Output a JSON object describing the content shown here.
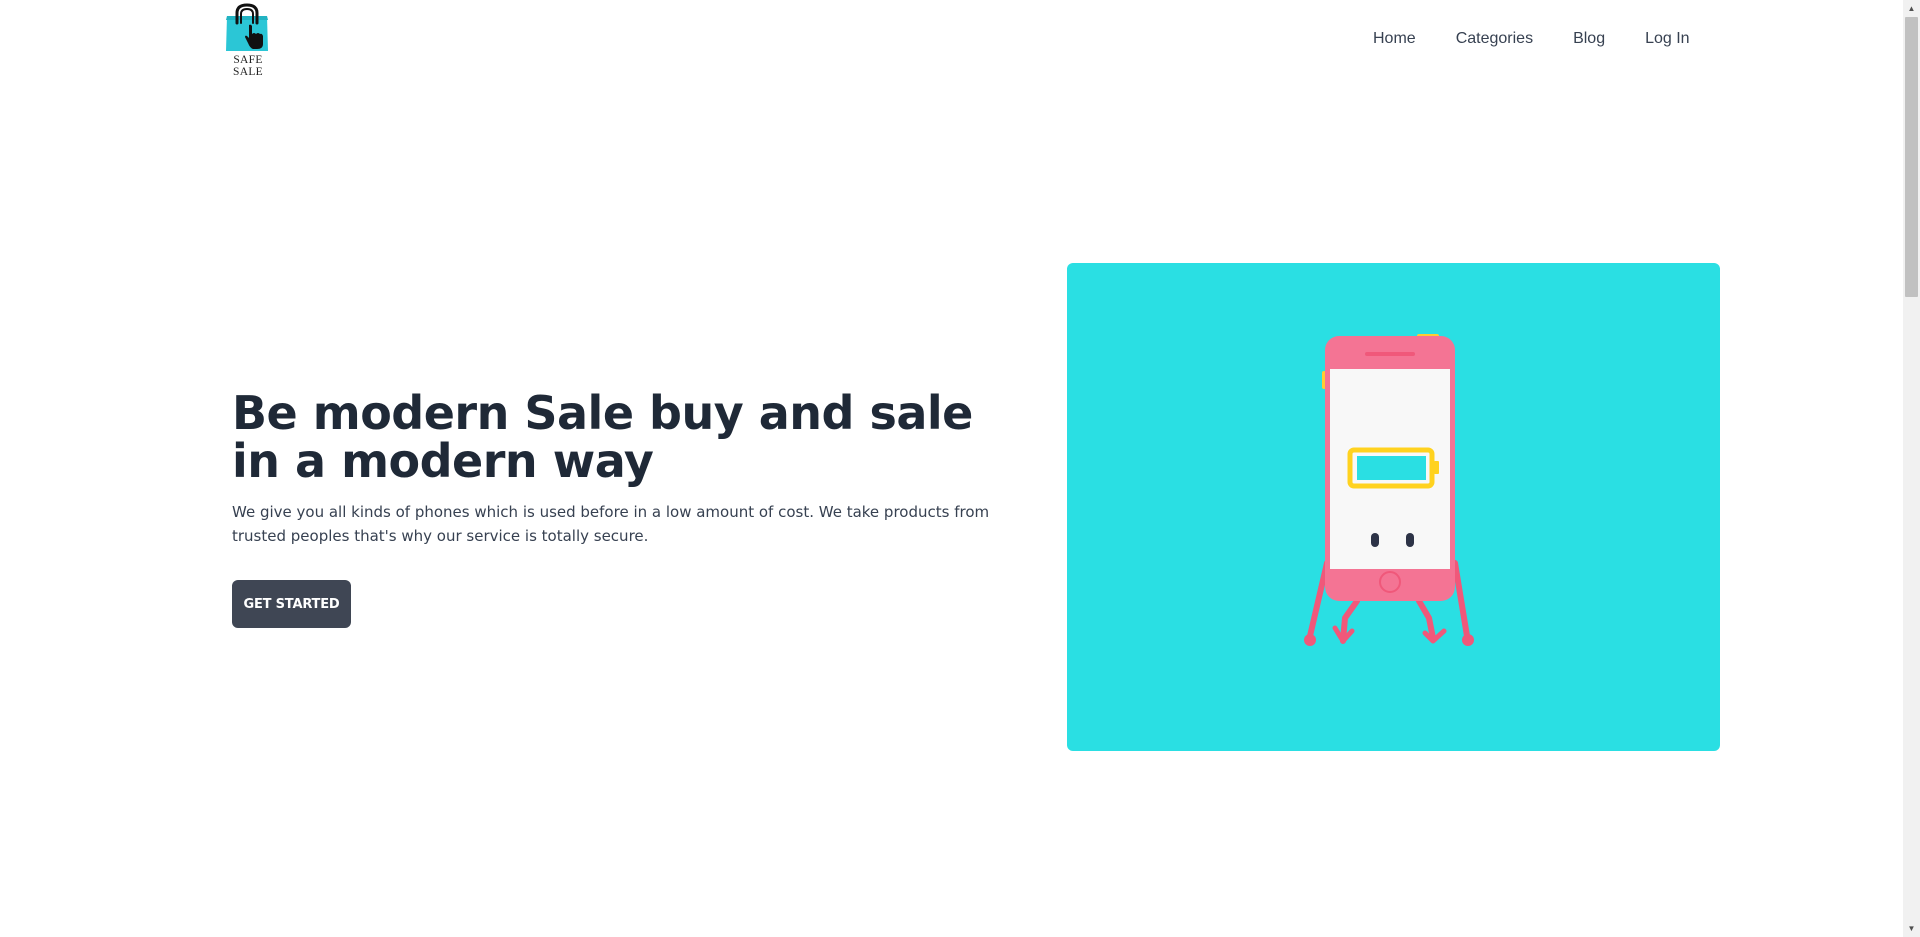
{
  "header": {
    "logo": {
      "text": "SAFE SALE",
      "icon": "shopping-bag-cursor-icon",
      "colors": {
        "bag": "#2bc6d6",
        "handle": "#111111"
      }
    },
    "nav": {
      "items": [
        {
          "label": "Home"
        },
        {
          "label": "Categories"
        },
        {
          "label": "Blog"
        },
        {
          "label": "Log In"
        }
      ]
    }
  },
  "hero": {
    "title": "Be modern Sale buy and sale in a modern way",
    "description": "We give you all kinds of phones which is used before in a low amount of cost. We take products from trusted peoples that's why our service is totally secure.",
    "cta_label": "GET STARTED",
    "illustration": {
      "icon": "walking-phone-battery-illustration",
      "colors": {
        "background": "#2adfe3",
        "phone": "#f47494",
        "screen": "#f8f8f8",
        "battery_outline": "#ffd21f",
        "battery_fill": "#2adfe3"
      }
    }
  },
  "colors": {
    "text_dark": "#1f2937",
    "button_bg": "#3f4654",
    "button_text": "#ffffff"
  },
  "scrollbar": {
    "up_icon": "arrow-up-icon",
    "down_icon": "arrow-down-icon"
  }
}
